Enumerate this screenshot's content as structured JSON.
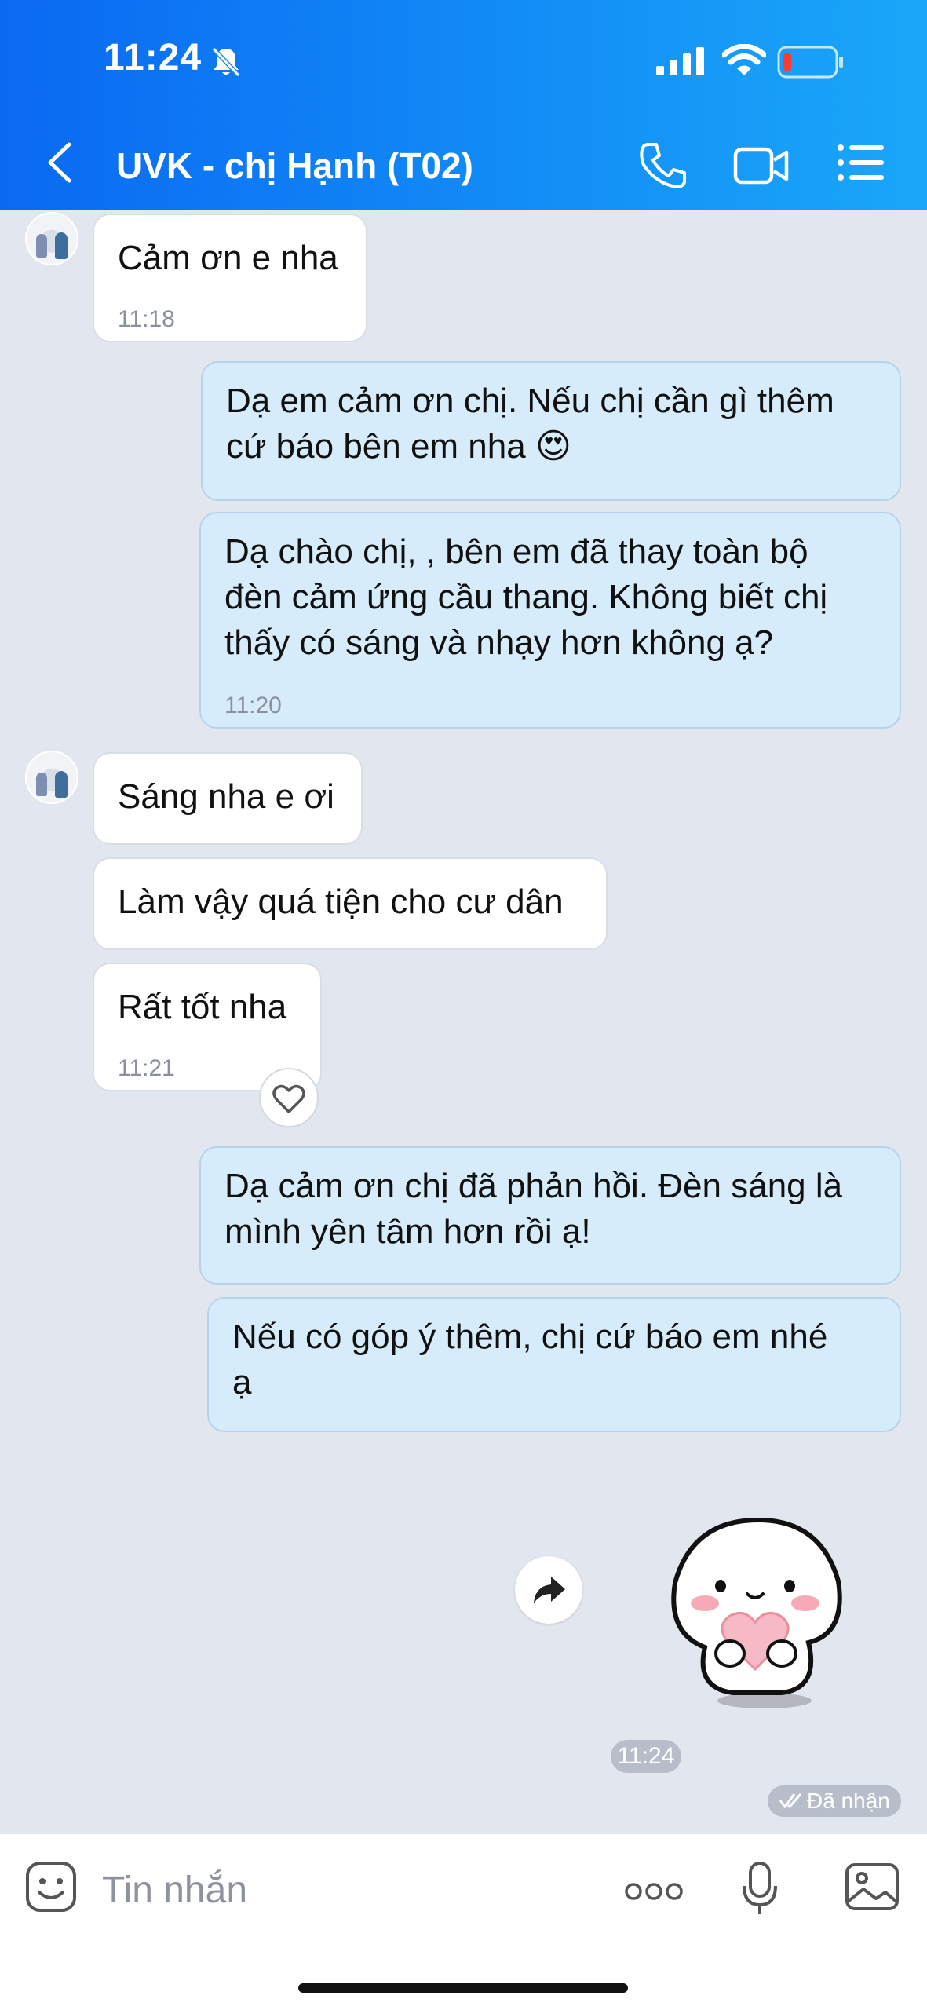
{
  "status_bar": {
    "time": "11:24"
  },
  "header": {
    "title": "UVK - chị Hạnh (T02)"
  },
  "messages": [
    {
      "text": "Cảm ơn e nha",
      "time": "11:18"
    },
    {
      "text": "Dạ em cảm ơn chị. Nếu chị cần gì thêm\ncứ báo bên em nha 😍"
    },
    {
      "text": "Dạ chào chị, , bên em đã thay toàn bộ\nđèn cảm ứng cầu thang. Không biết chị\nthấy có sáng và nhạy hơn không ạ?",
      "time": "11:20"
    },
    {
      "text": "Sáng nha e ơi"
    },
    {
      "text": "Làm vậy quá tiện cho cư dân"
    },
    {
      "text": "Rất tốt nha",
      "time": "11:21"
    },
    {
      "text": "Dạ cảm ơn chị đã phản hồi. Đèn sáng là\nmình yên tâm hơn rồi ạ!"
    },
    {
      "text": "Nếu có góp ý thêm, chị cứ báo em nhé\nạ"
    }
  ],
  "sticker_time": "11:24",
  "delivery_status": "Đã nhận",
  "input": {
    "placeholder": "Tin nhắn"
  },
  "colors": {
    "header_start": "#0a69f2",
    "header_end": "#1aa7f9",
    "outgoing_bubble": "#d6ecfb",
    "incoming_bubble": "#ffffff",
    "chat_background": "#e2e6ef"
  }
}
